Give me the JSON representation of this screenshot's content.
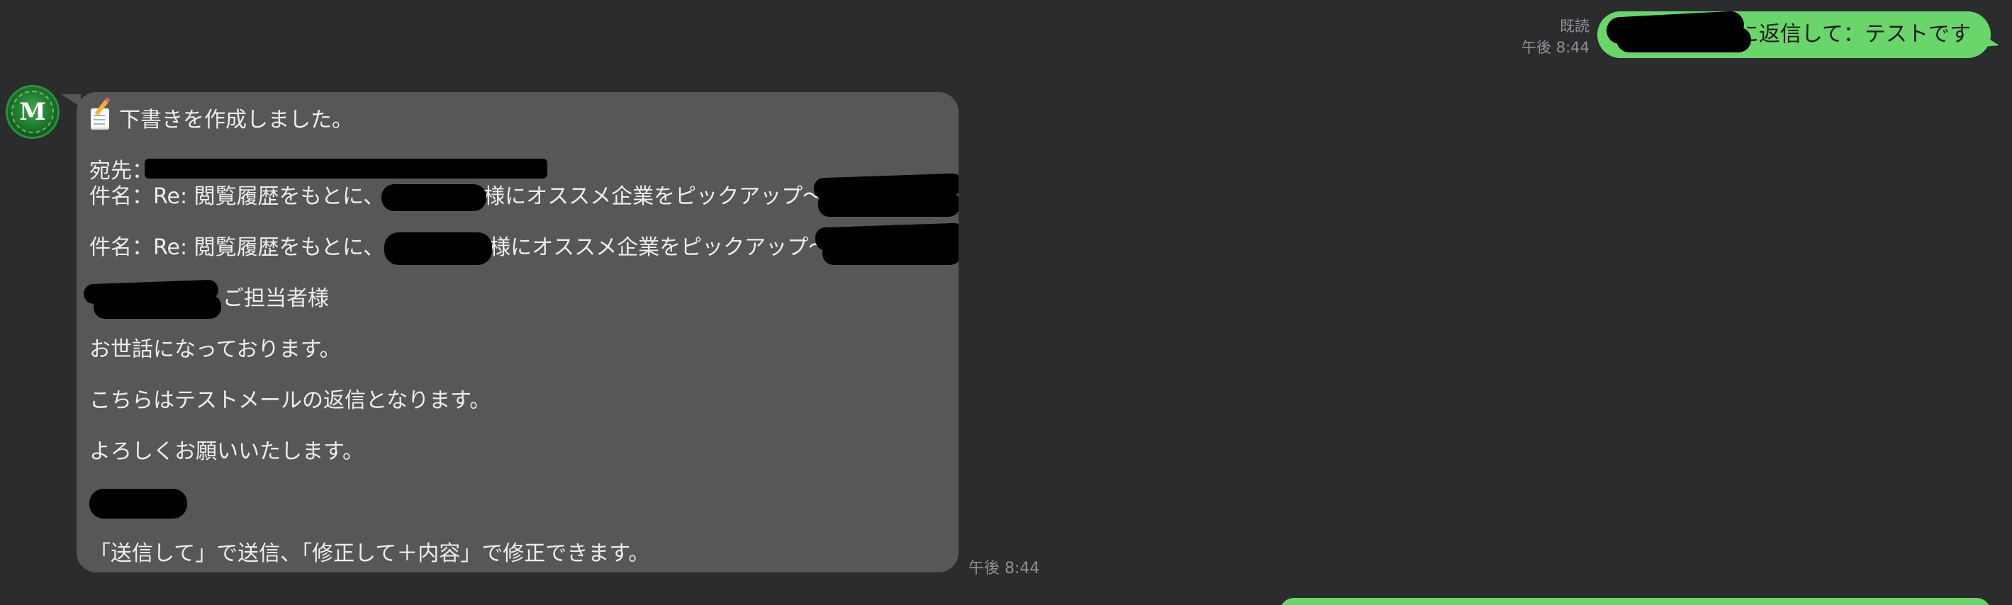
{
  "outgoing": {
    "read_label": "既読",
    "time": "午後 8:44",
    "text": "に返信して：テストです"
  },
  "avatar": {
    "letter": "M"
  },
  "incoming": {
    "icon": "memo-icon",
    "header": "下書きを作成しました。",
    "to_label": "宛先：",
    "subject_line_1": "件名：Re: 閲覧履歴をもとに、",
    "subject_suffix_1": "様にオススメ企業をピックアップ〜",
    "subject_line_2": "件名：Re: 閲覧履歴をもとに、",
    "subject_suffix_2": "様にオススメ企業をピックアップ〜",
    "recipient_suffix": "ご担当者様",
    "greeting": "お世話になっております。",
    "body": "こちらはテストメールの返信となります。",
    "closing": "よろしくお願いいたします。",
    "instructions": "「送信して」で送信、「修正して＋内容」で修正できます。",
    "time": "午後 8:44"
  },
  "colors": {
    "background": "#2b2c2e",
    "outgoing_bubble": "#6ad56b",
    "incoming_bubble": "#575757",
    "meta_text": "#8f9194"
  }
}
